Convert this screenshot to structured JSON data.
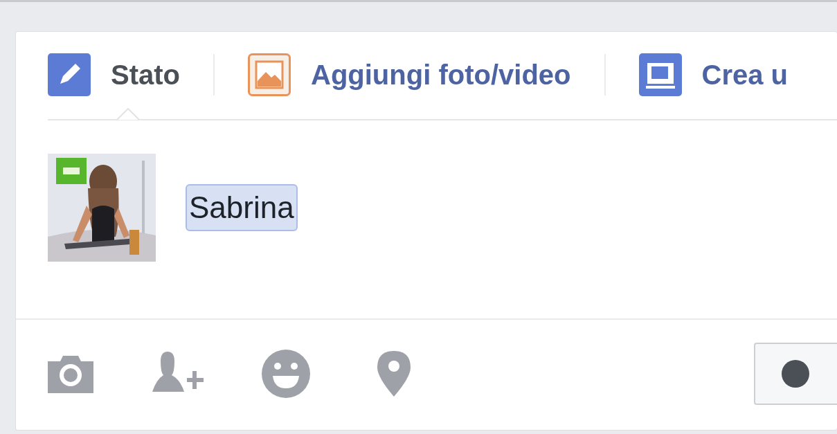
{
  "composer": {
    "tabs": [
      {
        "kind": "status",
        "label": "Stato",
        "selected": true
      },
      {
        "label": "Aggiungi foto/video",
        "selected": false
      },
      {
        "kind": "album",
        "label": "Crea u",
        "selected": false
      }
    ],
    "mention": "Sabrina"
  }
}
